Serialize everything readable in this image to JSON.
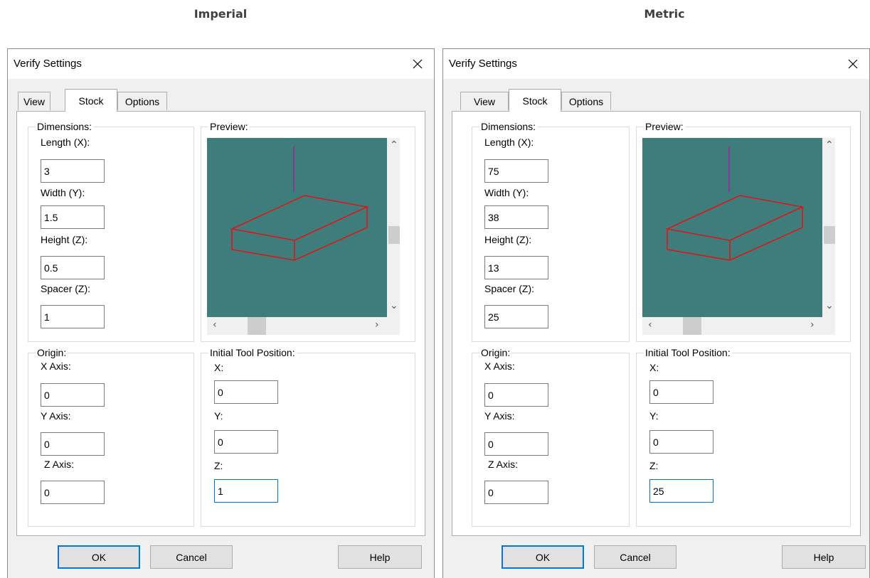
{
  "captions": {
    "left": "Imperial",
    "right": "Metric"
  },
  "dialog": {
    "title": "Verify Settings",
    "tabs": [
      "View",
      "Stock",
      "Options"
    ],
    "active_tab": "Stock",
    "groups": {
      "dimensions": "Dimensions:",
      "preview": "Preview:",
      "origin": "Origin:",
      "initial_tool_position": "Initial Tool Position:"
    },
    "labels": {
      "length": "Length (X):",
      "width": "Width (Y):",
      "height": "Height (Z):",
      "spacer": "Spacer (Z):",
      "x_axis": "X Axis:",
      "y_axis": "Y Axis:",
      "z_axis": "Z Axis:",
      "tool_x": "X:",
      "tool_y": "Y:",
      "tool_z": "Z:"
    },
    "buttons": {
      "ok": "OK",
      "cancel": "Cancel",
      "help": "Help"
    }
  },
  "imperial": {
    "length": "3",
    "width": "1.5",
    "height": "0.5",
    "spacer": "1",
    "origin_x": "0",
    "origin_y": "0",
    "origin_z": "0",
    "tool_x": "0",
    "tool_y": "0",
    "tool_z": "1"
  },
  "metric": {
    "length": "75",
    "width": "38",
    "height": "13",
    "spacer": "25",
    "origin_x": "0",
    "origin_y": "0",
    "origin_z": "0",
    "tool_x": "0",
    "tool_y": "0",
    "tool_z": "25"
  },
  "colors": {
    "preview_bg": "#3f7c7c",
    "stock_outline": "#ff0000",
    "tool_line": "#a020a0",
    "focus": "#0078d7"
  },
  "icons": {
    "close": "close-icon",
    "scroll_up": "chevron-up-icon",
    "scroll_down": "chevron-down-icon",
    "scroll_left": "chevron-left-icon",
    "scroll_right": "chevron-right-icon"
  }
}
